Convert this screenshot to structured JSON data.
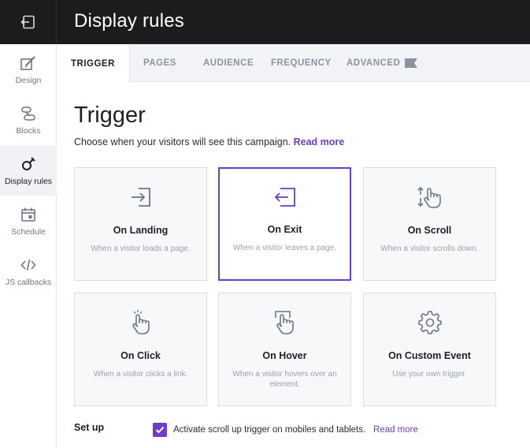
{
  "header": {
    "title": "Display rules"
  },
  "sidebar": {
    "items": [
      {
        "label": "Design"
      },
      {
        "label": "Blocks"
      },
      {
        "label": "Display rules"
      },
      {
        "label": "Schedule"
      },
      {
        "label": "JS callbacks"
      }
    ]
  },
  "tabs": [
    {
      "label": "TRIGGER"
    },
    {
      "label": "PAGES"
    },
    {
      "label": "AUDIENCE"
    },
    {
      "label": "FREQUENCY"
    },
    {
      "label": "ADVANCED"
    }
  ],
  "main": {
    "title": "Trigger",
    "subtitle": "Choose when your visitors will see this campaign.",
    "read_more": "Read more"
  },
  "cards": [
    {
      "title": "On Landing",
      "desc": "When a visitor loads a page.",
      "icon": "enter-icon"
    },
    {
      "title": "On Exit",
      "desc": "When a visitor leaves a page.",
      "icon": "exit-icon"
    },
    {
      "title": "On Scroll",
      "desc": "When a visitor scrolls down.",
      "icon": "scroll-hand-icon"
    },
    {
      "title": "On Click",
      "desc": "When a visitor clicks a link.",
      "icon": "click-hand-icon"
    },
    {
      "title": "On Hover",
      "desc": "When a visitor hovers over an element.",
      "icon": "hover-hand-icon"
    },
    {
      "title": "On Custom Event",
      "desc": "Use your own trigger.",
      "icon": "gear-icon"
    }
  ],
  "setup": {
    "label": "Set up",
    "checkbox_label": "Activate scroll up trigger on mobiles and tablets.",
    "checked": true,
    "read_more": "Read more"
  },
  "colors": {
    "accent": "#6b3ec7",
    "header_bg": "#1c1c1e"
  }
}
